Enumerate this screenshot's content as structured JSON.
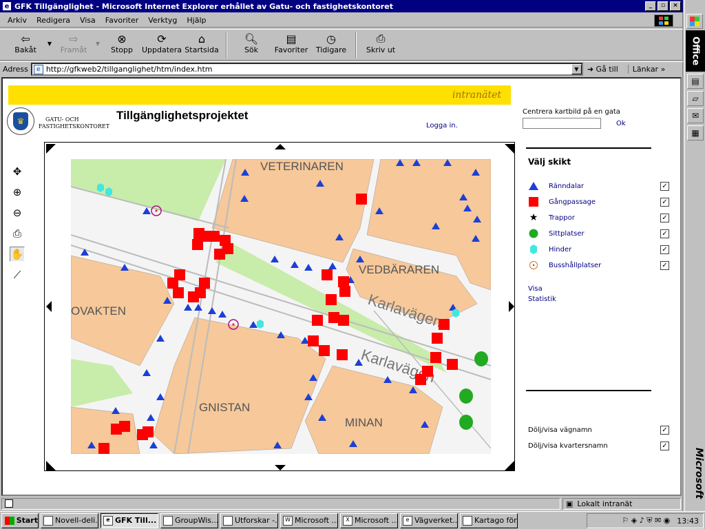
{
  "window": {
    "title": "GFK Tillgänglighet - Microsoft Internet Explorer erhållet av Gatu- och fastighetskontoret"
  },
  "menu": [
    "Arkiv",
    "Redigera",
    "Visa",
    "Favoriter",
    "Verktyg",
    "Hjälp"
  ],
  "toolbar": {
    "back": "Bakåt",
    "forward": "Framåt",
    "stop": "Stopp",
    "refresh": "Uppdatera",
    "home": "Startsida",
    "search": "Sök",
    "favorites": "Favoriter",
    "history": "Tidigare",
    "print": "Skriv ut"
  },
  "address": {
    "label": "Adress",
    "url": "http://gfkweb2/tillganglighet/htm/index.htm",
    "go": "Gå till",
    "links": "Länkar"
  },
  "page": {
    "banner": "intranätet",
    "org_line1": "GATU- OCH",
    "org_line2": "FASTIGHETSKONTORET",
    "title": "Tillgänglighetsprojektet",
    "login": "Logga in.",
    "center_label": "Centrera kartbild på en gata",
    "center_value": "",
    "ok": "Ok",
    "layers_title": "Välj skikt",
    "layers": [
      {
        "name": "Ränndalar",
        "symbol": "triangle",
        "color": "#1c3fd6",
        "checked": true
      },
      {
        "name": "Gångpassage",
        "symbol": "square",
        "color": "#ff0000",
        "checked": true
      },
      {
        "name": "Trappor",
        "symbol": "star",
        "color": "#000000",
        "checked": true
      },
      {
        "name": "Sittplatser",
        "symbol": "circle",
        "color": "#22aa22",
        "checked": true
      },
      {
        "name": "Hinder",
        "symbol": "hexagon",
        "color": "#40e8e0",
        "checked": true
      },
      {
        "name": "Busshållplatser",
        "symbol": "bus",
        "color": "#cc2222",
        "checked": true
      }
    ],
    "visa": "Visa",
    "statistik": "Statistik",
    "toggle_streets": "Dölj/visa vägnamn",
    "toggle_blocks": "Dölj/visa kvartersnamn",
    "map_labels": [
      "VETERINAREN",
      "VEDBÄRAREN",
      "OVAKTEN",
      "GNISTAN",
      "MINAN",
      "Karlavägen",
      "Karlavägen"
    ]
  },
  "status": {
    "zone": "Lokalt intranät"
  },
  "taskbar": {
    "start": "Start",
    "tasks": [
      "Novell-deli...",
      "GFK Till...",
      "GroupWis...",
      "Utforskar -...",
      "Microsoft ...",
      "Microsoft ...",
      "Vägverket...",
      "Kartago för..."
    ],
    "time": "13:43"
  },
  "office": {
    "label": "Office",
    "brand": "Microsoft"
  }
}
